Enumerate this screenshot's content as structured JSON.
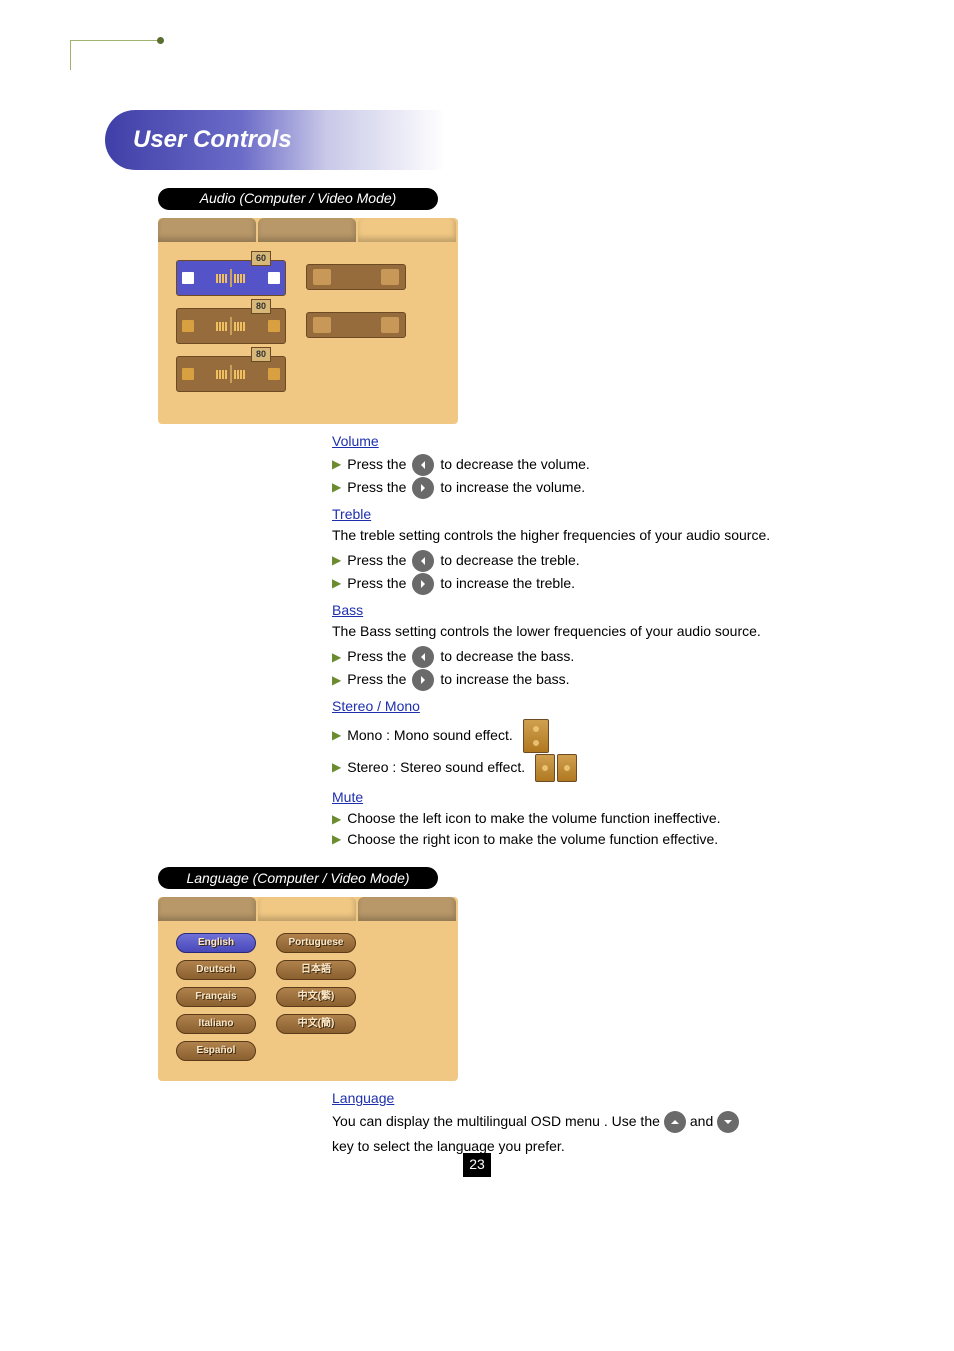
{
  "banner": {
    "title": "User Controls"
  },
  "audio_section": {
    "pill_label": "Audio (Computer / Video Mode)",
    "sliders": {
      "volume_value": "60",
      "treble_value": "80",
      "bass_value": "80"
    },
    "items": [
      {
        "heading": "Volume",
        "desc": "",
        "press1_pre": "Press the",
        "press1_post": "to decrease the volume.",
        "press2_pre": "Press the",
        "press2_post": "to increase the volume."
      },
      {
        "heading": "Treble",
        "desc": "The treble setting controls the higher frequencies of your audio source.",
        "press1_pre": "Press the",
        "press1_post": "to decrease the treble.",
        "press2_pre": "Press the",
        "press2_post": "to increase the treble."
      },
      {
        "heading": "Bass",
        "desc": "The Bass setting controls the lower frequencies  of your audio source.",
        "press1_pre": "Press the",
        "press1_post": "to decrease the bass.",
        "press2_pre": "Press the",
        "press2_post": "to increase the bass."
      },
      {
        "heading": "Stereo / Mono",
        "mono_pre": "Mono : Mono sound effect.",
        "stereo_pre": "Stereo : Stereo sound effect."
      },
      {
        "heading": "Mute",
        "mute_on_pre": "Choose the left icon to make the volume function ineffective.",
        "mute_off_pre": "Choose the right icon to make the volume function effective."
      }
    ]
  },
  "language_section": {
    "pill_label": "Language (Computer / Video Mode)",
    "languages_col1": [
      "English",
      "Deutsch",
      "Français",
      "Italiano",
      "Español"
    ],
    "languages_col2": [
      "Portuguese",
      "日本語",
      "中文(繁)",
      "中文(簡)"
    ],
    "heading": "Language",
    "desc_pre": "You can display the multilingual OSD menu . Use the",
    "desc_mid": "and",
    "desc_post": "key to select the language you prefer."
  },
  "page_number": "23"
}
